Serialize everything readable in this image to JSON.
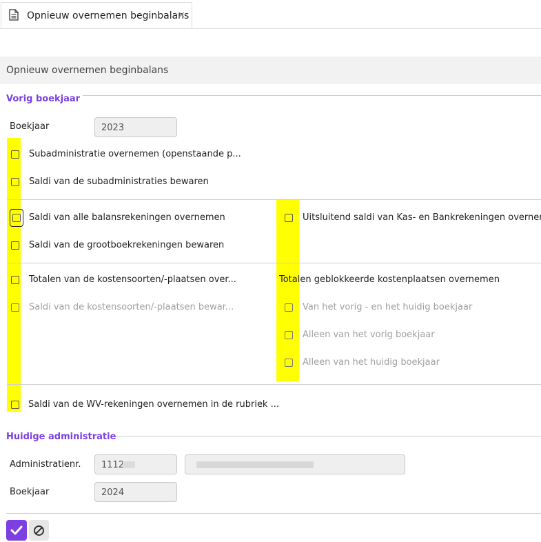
{
  "tab": {
    "label": "Opnieuw overnemen beginbalans",
    "icon": "document-icon",
    "close_icon": "close-icon"
  },
  "panel": {
    "title": "Opnieuw overnemen beginbalans"
  },
  "sections": {
    "previous_year": {
      "title": "Vorig boekjaar",
      "boekjaar_label": "Boekjaar",
      "boekjaar_value": "2023"
    },
    "current_admin": {
      "title": "Huidige administratie",
      "admin_label": "Administratienr.",
      "admin_value": "1112",
      "boekjaar_label": "Boekjaar",
      "boekjaar_value": "2024"
    }
  },
  "options": {
    "subadmin_overnemen": "Subadministratie overnemen (openstaande p...",
    "saldi_subadmin_bewaren": "Saldi van de subadministraties bewaren",
    "saldi_balans_overnemen": "Saldi van alle balansrekeningen overnemen",
    "saldi_grootboek_bewaren": "Saldi van de grootboekrekeningen bewaren",
    "uitsluitend_kas_bank": "Uitsluitend saldi van Kas- en Bankrekeningen overnem",
    "totalen_kosten_over": "Totalen van de kostensoorten/-plaatsen over...",
    "saldi_kosten_bewar": "Saldi van de kostensoorten/-plaatsen bewar...",
    "geblokkeerd_title": "Totalen geblokkeerde kostenplaatsen overnemen",
    "vorig_en_huidig": "Van het vorig - en het huidig boekjaar",
    "alleen_vorig": "Alleen van het vorig boekjaar",
    "alleen_huidig": "Alleen van het huidig boekjaar",
    "saldi_wv": "Saldi van de WV-rekeningen overnemen in de rubriek ..."
  },
  "buttons": {
    "ok_icon": "check-icon",
    "cancel_icon": "cancel-icon"
  },
  "colors": {
    "accent": "#7b3fe4",
    "highlight": "#ffff00"
  }
}
